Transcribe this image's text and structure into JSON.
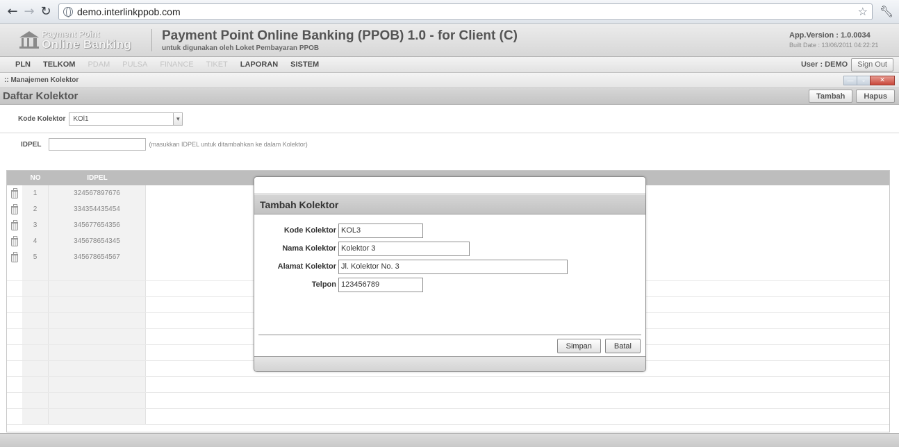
{
  "browser": {
    "url": "demo.interlinkppob.com",
    "back_icon": "arrow-left-icon",
    "forward_icon": "arrow-right-icon",
    "reload_icon": "reload-icon",
    "bookmark_icon": "star-icon",
    "menu_icon": "wrench-icon"
  },
  "header": {
    "logo_line1": "Payment Point",
    "logo_line2": "Online Banking",
    "title": "Payment Point Online Banking (PPOB)  1.0 - for Client (C)",
    "subtitle": "untuk digunakan oleh Loket Pembayaran PPOB",
    "app_version": "App.Version : 1.0.0034",
    "build_date": "Built Date : 13/06/2011 04:22:21"
  },
  "menu": {
    "items": [
      {
        "label": "PLN",
        "enabled": true
      },
      {
        "label": "TELKOM",
        "enabled": true
      },
      {
        "label": "PDAM",
        "enabled": false
      },
      {
        "label": "PULSA",
        "enabled": false
      },
      {
        "label": "FINANCE",
        "enabled": false
      },
      {
        "label": "TIKET",
        "enabled": false
      },
      {
        "label": "LAPORAN",
        "enabled": true
      },
      {
        "label": "SISTEM",
        "enabled": true
      }
    ],
    "user": "User : DEMO",
    "signout_label": "Sign Out"
  },
  "window": {
    "title": ":: Manajemen Kolektor"
  },
  "section": {
    "title": "Daftar Kolektor",
    "add_label": "Tambah",
    "delete_label": "Hapus"
  },
  "filter": {
    "kode_label": "Kode Kolektor",
    "kode_value": "KOl1",
    "idpel_label": "IDPEL",
    "idpel_value": "",
    "idpel_hint": "(masukkan IDPEL untuk ditambahkan ke dalam Kolektor)"
  },
  "grid": {
    "columns": [
      "NO",
      "IDPEL"
    ],
    "rows": [
      {
        "no": "1",
        "idpel": "324567897676"
      },
      {
        "no": "2",
        "idpel": "334354435454"
      },
      {
        "no": "3",
        "idpel": "345677654356"
      },
      {
        "no": "4",
        "idpel": "345678654345"
      },
      {
        "no": "5",
        "idpel": "345678654567"
      }
    ]
  },
  "modal": {
    "title": "Tambah Kolektor",
    "fields": [
      {
        "label": "Kode Kolektor",
        "value": "KOL3"
      },
      {
        "label": "Nama Kolektor",
        "value": "Kolektor 3"
      },
      {
        "label": "Alamat Kolektor",
        "value": "Jl. Kolektor No. 3"
      },
      {
        "label": "Telpon",
        "value": "123456789"
      }
    ],
    "save_label": "Simpan",
    "cancel_label": "Batal"
  }
}
